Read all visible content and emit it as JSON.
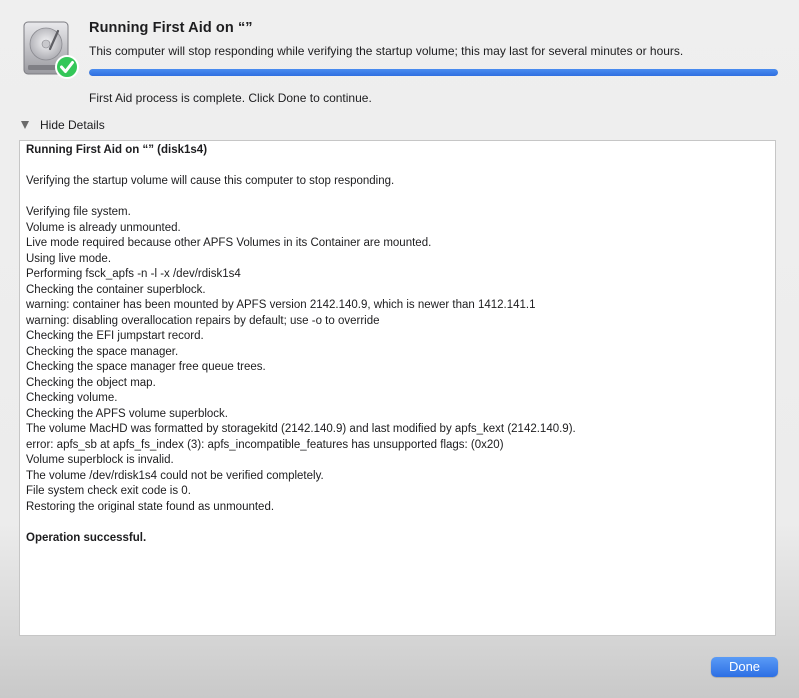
{
  "header": {
    "title": "Running First Aid on “”",
    "subtitle": "This computer will stop responding while verifying the startup volume; this may last for several minutes or hours.",
    "status": "First Aid process is complete. Click Done to continue."
  },
  "progress": {
    "fraction": 1.0,
    "color": "#2f6fe0"
  },
  "details": {
    "toggle_label": "Hide Details",
    "toggle_icon": "disclosure-triangle-down-icon"
  },
  "log": {
    "lines": [
      {
        "text": "Running First Aid on “” (disk1s4)",
        "bold": true
      },
      {
        "text": "",
        "bold": false
      },
      {
        "text": "Verifying the startup volume will cause this computer to stop responding.",
        "bold": false
      },
      {
        "text": "",
        "bold": false
      },
      {
        "text": "Verifying file system.",
        "bold": false
      },
      {
        "text": "Volume is already unmounted.",
        "bold": false
      },
      {
        "text": "Live mode required because other APFS Volumes in its Container are mounted.",
        "bold": false
      },
      {
        "text": "Using live mode.",
        "bold": false
      },
      {
        "text": "Performing fsck_apfs -n -l -x /dev/rdisk1s4",
        "bold": false
      },
      {
        "text": "Checking the container superblock.",
        "bold": false
      },
      {
        "text": "warning: container has been mounted by APFS version 2142.140.9, which is newer than 1412.141.1",
        "bold": false
      },
      {
        "text": "warning: disabling overallocation repairs by default; use -o to override",
        "bold": false
      },
      {
        "text": "Checking the EFI jumpstart record.",
        "bold": false
      },
      {
        "text": "Checking the space manager.",
        "bold": false
      },
      {
        "text": "Checking the space manager free queue trees.",
        "bold": false
      },
      {
        "text": "Checking the object map.",
        "bold": false
      },
      {
        "text": "Checking volume.",
        "bold": false
      },
      {
        "text": "Checking the APFS volume superblock.",
        "bold": false
      },
      {
        "text": "The volume MacHD was formatted by storagekitd (2142.140.9) and last modified by apfs_kext (2142.140.9).",
        "bold": false
      },
      {
        "text": "error: apfs_sb at apfs_fs_index (3): apfs_incompatible_features has unsupported flags: (0x20)",
        "bold": false
      },
      {
        "text": "Volume superblock is invalid.",
        "bold": false
      },
      {
        "text": "The volume /dev/rdisk1s4 could not be verified completely.",
        "bold": false
      },
      {
        "text": "File system check exit code is 0.",
        "bold": false
      },
      {
        "text": "Restoring the original state found as unmounted.",
        "bold": false
      },
      {
        "text": "",
        "bold": false
      },
      {
        "text": "Operation successful.",
        "bold": true
      }
    ]
  },
  "footer": {
    "done_label": "Done"
  },
  "icons": {
    "disk": "hard-disk-icon",
    "badge": "checkmark-badge-icon"
  },
  "colors": {
    "accent": "#2d6fe4",
    "check_green": "#34c759"
  }
}
